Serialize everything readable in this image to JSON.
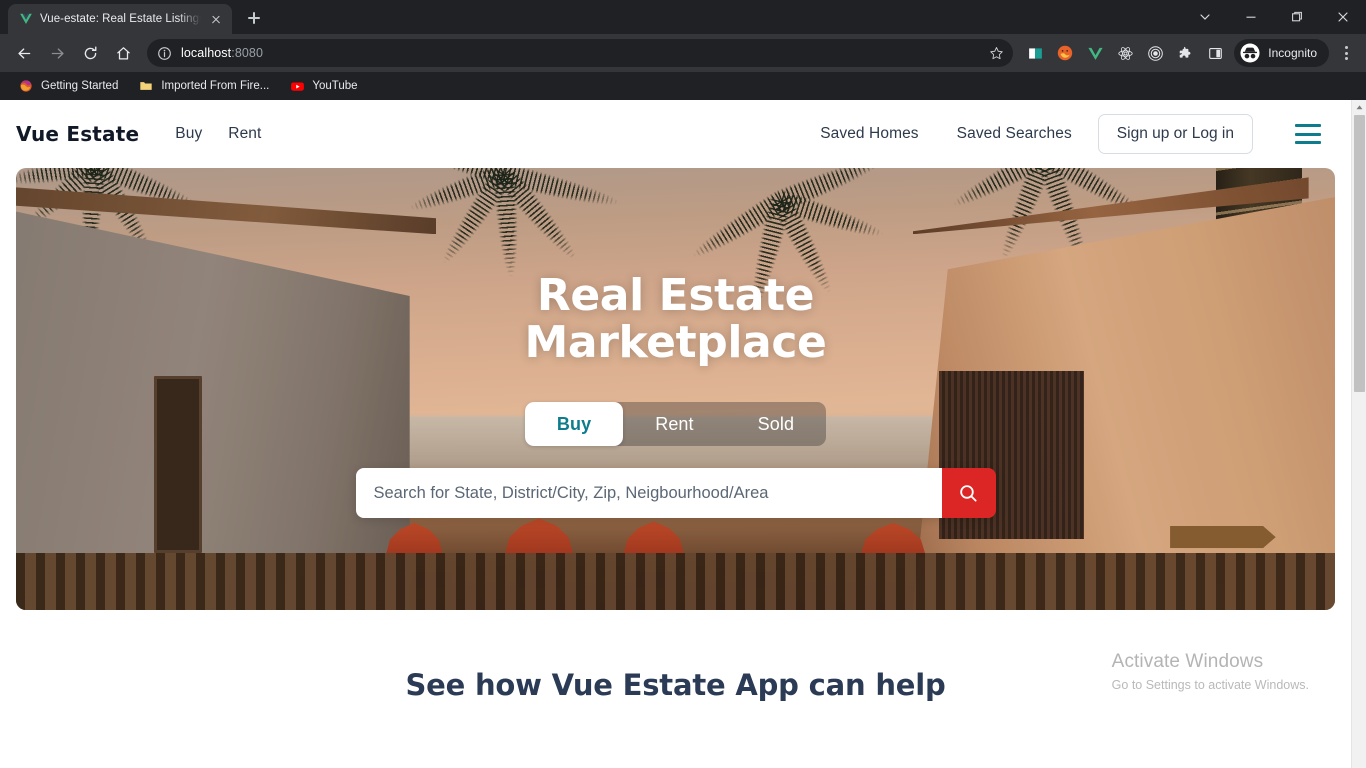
{
  "browser": {
    "tab": {
      "title": "Vue-estate: Real Estate Listings, H",
      "favicon": "vue-logo-icon",
      "close_label": "Close tab"
    },
    "new_tab_label": "New Tab",
    "window_controls": [
      "tab-search-chevron",
      "minimize",
      "maximize",
      "close"
    ],
    "nav": {
      "back_label": "Back",
      "forward_label": "Forward",
      "reload_label": "Reload",
      "home_label": "Home"
    },
    "omnibox": {
      "host": "localhost",
      "port": ":8080",
      "info_icon": "site-information-icon",
      "bookmark_icon": "bookmark-star-icon"
    },
    "extensions": [
      {
        "name": "reading-list-icon"
      },
      {
        "name": "firefox-extension-icon"
      },
      {
        "name": "vue-devtools-icon"
      },
      {
        "name": "react-devtools-icon"
      },
      {
        "name": "target-extension-icon"
      },
      {
        "name": "puzzle-extensions-icon"
      },
      {
        "name": "side-panel-icon"
      }
    ],
    "incognito": {
      "label": "Incognito",
      "icon": "incognito-hat-icon"
    },
    "menu_label": "Customize and control Google Chrome",
    "bookmarks": [
      {
        "label": "Getting Started",
        "icon": "firefox-icon"
      },
      {
        "label": "Imported From Fire...",
        "icon": "folder-icon"
      },
      {
        "label": "YouTube",
        "icon": "youtube-icon"
      }
    ]
  },
  "site": {
    "brand": "Vue Estate",
    "nav_left": [
      {
        "label": "Buy"
      },
      {
        "label": "Rent"
      }
    ],
    "nav_right": [
      {
        "label": "Saved Homes"
      },
      {
        "label": "Saved Searches"
      }
    ],
    "signup_label": "Sign up or Log in",
    "menu_icon": "hamburger-menu-icon"
  },
  "hero": {
    "title_line1": "Real Estate",
    "title_line2": "Marketplace",
    "tabs": [
      {
        "label": "Buy",
        "active": true
      },
      {
        "label": "Rent",
        "active": false
      },
      {
        "label": "Sold",
        "active": false
      }
    ],
    "search": {
      "placeholder": "Search for State, District/City, Zip, Neigbourhood/Area",
      "value": "",
      "button_icon": "search-magnifier-icon",
      "button_color": "#dc2626"
    }
  },
  "section": {
    "title": "See how Vue Estate App can help"
  },
  "watermark": {
    "title": "Activate Windows",
    "subtitle": "Go to Settings to activate Windows."
  },
  "colors": {
    "accent_teal": "#0d7c8c",
    "accent_red": "#dc2626",
    "heading_navy": "#2b3a55",
    "chrome_dark": "#202124"
  }
}
